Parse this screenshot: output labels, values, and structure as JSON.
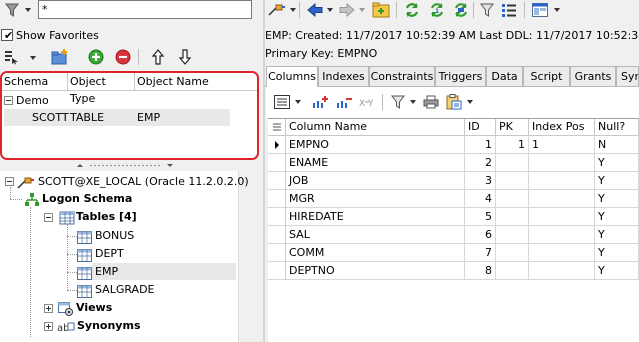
{
  "left_toolbar": {
    "filter_value": "*",
    "show_favorites_label": "Show Favorites",
    "show_favorites_checked": true
  },
  "favorites": {
    "columns": [
      "Schema",
      "Object Type",
      "Object Name"
    ],
    "group": "Demo",
    "row": {
      "schema": "SCOTT",
      "object_type": "TABLE",
      "object_name": "EMP"
    }
  },
  "tree": {
    "connection": "SCOTT@XE_LOCAL (Oracle 11.2.0.2.0)",
    "logon_schema": "Logon Schema",
    "tables_label": "Tables [4]",
    "tables": [
      "BONUS",
      "DEPT",
      "EMP",
      "SALGRADE"
    ],
    "views": "Views",
    "synonyms": "Synonyms"
  },
  "info": {
    "line1": "EMP:  Created: 11/7/2017 10:52:39 AM  Last DDL: 11/7/2017 10:52:39 AM",
    "primary_key": "Primary Key:  EMPNO"
  },
  "tabs": [
    "Columns",
    "Indexes",
    "Constraints",
    "Triggers",
    "Data",
    "Script",
    "Grants",
    "Syn"
  ],
  "columns_grid": {
    "headers": [
      "Column Name",
      "ID",
      "PK",
      "Index Pos",
      "Null?"
    ],
    "rows": [
      {
        "name": "EMPNO",
        "id": "1",
        "pk": "1",
        "index_pos": "1",
        "null": "N"
      },
      {
        "name": "ENAME",
        "id": "2",
        "pk": "",
        "index_pos": "",
        "null": "Y"
      },
      {
        "name": "JOB",
        "id": "3",
        "pk": "",
        "index_pos": "",
        "null": "Y"
      },
      {
        "name": "MGR",
        "id": "4",
        "pk": "",
        "index_pos": "",
        "null": "Y"
      },
      {
        "name": "HIREDATE",
        "id": "5",
        "pk": "",
        "index_pos": "",
        "null": "Y"
      },
      {
        "name": "SAL",
        "id": "6",
        "pk": "",
        "index_pos": "",
        "null": "Y"
      },
      {
        "name": "COMM",
        "id": "7",
        "pk": "",
        "index_pos": "",
        "null": "Y"
      },
      {
        "name": "DEPTNO",
        "id": "8",
        "pk": "",
        "index_pos": "",
        "null": "Y"
      }
    ]
  },
  "colors": {
    "highlight_border": "#e0242e",
    "selected_row": "#e8e8e8",
    "arrow_blue": "#2b63c8",
    "refresh_green": "#2e9a2e"
  }
}
